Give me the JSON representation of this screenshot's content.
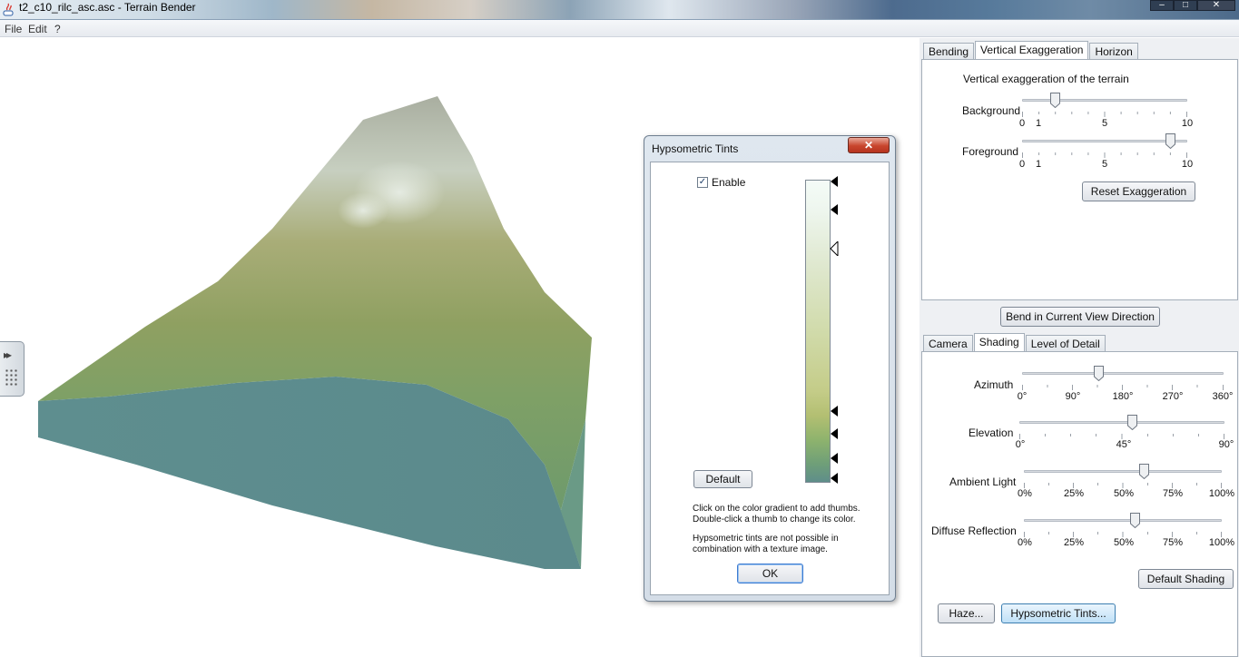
{
  "window": {
    "title": "t2_c10_rilc_asc.asc - Terrain Bender",
    "minimize_glyph": "–",
    "maximize_glyph": "□",
    "close_glyph": "✕"
  },
  "menu": {
    "items": [
      "File",
      "Edit",
      "?"
    ]
  },
  "side_handle": {
    "arrows": "▸▸"
  },
  "dialog": {
    "title": "Hypsometric Tints",
    "close_glyph": "✕",
    "enable_label": "Enable",
    "enable_checked": "✓",
    "default_button": "Default",
    "hint_1": "Click on the color gradient to add thumbs.",
    "hint_2": "Double-click a thumb to change its color.",
    "hint_3": "Hypsometric tints are not possible in",
    "hint_4": "combination with a texture image.",
    "ok_button": "OK"
  },
  "top_tabs": {
    "items": [
      "Bending",
      "Vertical Exaggeration",
      "Horizon"
    ],
    "active": "Vertical Exaggeration"
  },
  "exaggeration": {
    "heading": "Vertical exaggeration of the terrain",
    "background_label": "Background",
    "background_value": 2,
    "foreground_label": "Foreground",
    "foreground_value": 9,
    "ticks": [
      "0",
      "1",
      "5",
      "10"
    ],
    "reset_button": "Reset Exaggeration"
  },
  "bend_button": "Bend in Current View Direction",
  "bottom_tabs": {
    "items": [
      "Camera",
      "Shading",
      "Level of Detail"
    ],
    "active": "Shading"
  },
  "shading": {
    "azimuth_label": "Azimuth",
    "azimuth_ticks": [
      "0°",
      "90°",
      "180°",
      "270°",
      "360°"
    ],
    "azimuth_value": 0.38,
    "elevation_label": "Elevation",
    "elevation_ticks": [
      "0°",
      "45°",
      "90°"
    ],
    "elevation_value": 0.55,
    "ambient_label": "Ambient Light",
    "ambient_ticks": [
      "0%",
      "25%",
      "50%",
      "75%",
      "100%"
    ],
    "ambient_value": 0.61,
    "diffuse_label": "Diffuse Reflection",
    "diffuse_ticks": [
      "0%",
      "25%",
      "50%",
      "75%",
      "100%"
    ],
    "diffuse_value": 0.56,
    "default_button": "Default Shading",
    "haze_button": "Haze...",
    "tints_button": "Hypsometric Tints..."
  }
}
